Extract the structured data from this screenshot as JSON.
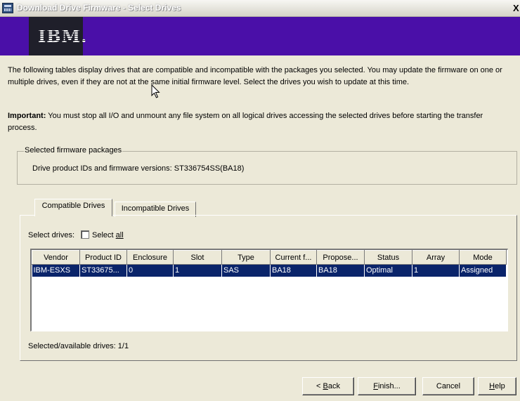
{
  "window": {
    "title": "Download Drive Firmware - Select Drives",
    "close_label": "X",
    "brand": "IBM.",
    "colors": {
      "banner": "#4a0fa8",
      "logo_background": "#1f1f2a",
      "selection": "#0a246a",
      "face": "#ece9d8"
    }
  },
  "description": "The following tables display drives that are compatible and incompatible with the packages you selected. You may update the firmware on one or multiple drives, even if they are not at the same initial firmware level. Select the drives you wish to update at this time.",
  "important": {
    "label": "Important:",
    "text": " You must stop all I/O and unmount any file system on all logical drives accessing the selected drives before starting the transfer process."
  },
  "firmware_group": {
    "legend": "Selected firmware packages",
    "label": "Drive product IDs and firmware versions:",
    "value": " ST336754SS(BA18)"
  },
  "tabs": [
    {
      "label": "Compatible Drives",
      "selected": true
    },
    {
      "label": "Incompatible Drives",
      "selected": false
    }
  ],
  "select": {
    "label": "Select drives:",
    "checkbox_label_prefix": "Select ",
    "checkbox_label_mnemonic": "all",
    "checked": false
  },
  "table": {
    "columns": [
      "Vendor",
      "Product ID",
      "Enclosure",
      "Slot",
      "Type",
      "Current f...",
      "Propose...",
      "Status",
      "Array",
      "Mode"
    ],
    "rows": [
      [
        "IBM-ESXS",
        "ST33675...",
        "0",
        "1",
        "SAS",
        "BA18",
        "BA18",
        "Optimal",
        "1",
        "Assigned"
      ]
    ]
  },
  "footer": {
    "label": "Selected/available drives:",
    "value": " 1/1"
  },
  "buttons": {
    "back": {
      "prefix": "< ",
      "mnemonic": "B",
      "rest": "ack"
    },
    "finish": {
      "mnemonic": "F",
      "rest": "inish..."
    },
    "cancel": {
      "label": "Cancel"
    },
    "help": {
      "mnemonic": "H",
      "rest": "elp"
    }
  },
  "icons": [
    "app-icon",
    "close-icon",
    "ibm-logo",
    "mouse-pointer-icon",
    "checkbox-icon"
  ]
}
